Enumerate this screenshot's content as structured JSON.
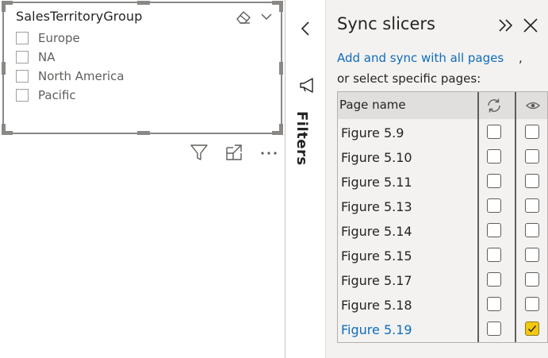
{
  "slicer": {
    "title": "SalesTerritoryGroup",
    "items": [
      {
        "label": "Europe",
        "checked": false
      },
      {
        "label": "NA",
        "checked": false
      },
      {
        "label": "North America",
        "checked": false
      },
      {
        "label": "Pacific",
        "checked": false
      }
    ],
    "header_icons": [
      "eraser-icon",
      "chevron-down-icon"
    ],
    "toolbar_icons": [
      "filter-icon",
      "focus-mode-icon",
      "more-options-icon"
    ]
  },
  "filters_pane": {
    "label": "Filters",
    "icons": [
      "chevron-left-icon",
      "megaphone-icon"
    ]
  },
  "sync_pane": {
    "title": "Sync slicers",
    "link_text": "Add and sync with all pages",
    "link_suffix": ",",
    "subtext": "or select specific pages:",
    "header_icons": [
      "expand-icon",
      "close-icon"
    ],
    "table": {
      "col_page": "Page name",
      "col_sync_icon": "sync-icon",
      "col_visible_icon": "eye-icon",
      "rows": [
        {
          "page": "Figure 5.9",
          "sync": false,
          "visible": false,
          "active": false
        },
        {
          "page": "Figure 5.10",
          "sync": false,
          "visible": false,
          "active": false
        },
        {
          "page": "Figure 5.11",
          "sync": false,
          "visible": false,
          "active": false
        },
        {
          "page": "Figure 5.13",
          "sync": false,
          "visible": false,
          "active": false
        },
        {
          "page": "Figure 5.14",
          "sync": false,
          "visible": false,
          "active": false
        },
        {
          "page": "Figure 5.15",
          "sync": false,
          "visible": false,
          "active": false
        },
        {
          "page": "Figure 5.17",
          "sync": false,
          "visible": false,
          "active": false
        },
        {
          "page": "Figure 5.18",
          "sync": false,
          "visible": false,
          "active": false
        },
        {
          "page": "Figure 5.19",
          "sync": false,
          "visible": true,
          "active": true
        }
      ]
    }
  },
  "colors": {
    "accent_link": "#0f6cbd",
    "checked_fill": "#f2c811",
    "pane_bg": "#f3f2f1"
  }
}
